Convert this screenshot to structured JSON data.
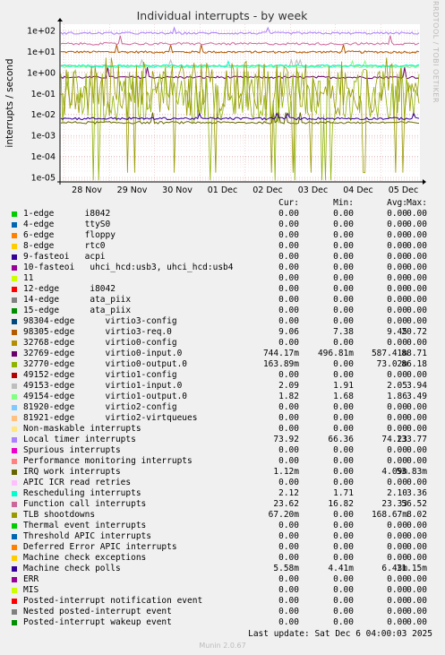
{
  "chart_data": {
    "type": "line",
    "title": "Individual interrupts - by week",
    "ylabel": "interrupts / second",
    "yscale": "log",
    "ylim": [
      7e-06,
      200
    ],
    "yticks": [
      "1e+02",
      "1e+01",
      "1e+00",
      "1e-01",
      "1e-02",
      "1e-03",
      "1e-04",
      "1e-05"
    ],
    "xticks": [
      "28 Nov",
      "29 Nov",
      "30 Nov",
      "01 Dec",
      "02 Dec",
      "03 Dec",
      "04 Dec",
      "05 Dec"
    ],
    "side_label": "RRDTOOL / TOBI OETIKER",
    "columns": [
      "Cur:",
      "Min:",
      "Avg:",
      "Max:"
    ],
    "series": [
      {
        "name": "1-edge      i8042",
        "color": "#00cc00",
        "cur": "0.00",
        "min": "0.00",
        "avg": "0.00",
        "max": "0.00"
      },
      {
        "name": "4-edge      ttyS0",
        "color": "#0066b3",
        "cur": "0.00",
        "min": "0.00",
        "avg": "0.00",
        "max": "0.00"
      },
      {
        "name": "6-edge      floppy",
        "color": "#ff8000",
        "cur": "0.00",
        "min": "0.00",
        "avg": "0.00",
        "max": "0.00"
      },
      {
        "name": "8-edge      rtc0",
        "color": "#ffcc00",
        "cur": "0.00",
        "min": "0.00",
        "avg": "0.00",
        "max": "0.00"
      },
      {
        "name": "9-fasteoi   acpi",
        "color": "#330099",
        "cur": "0.00",
        "min": "0.00",
        "avg": "0.00",
        "max": "0.00"
      },
      {
        "name": "10-fasteoi   uhci_hcd:usb3, uhci_hcd:usb4",
        "color": "#990099",
        "cur": "0.00",
        "min": "0.00",
        "avg": "0.00",
        "max": "0.00"
      },
      {
        "name": "11",
        "color": "#ccff00",
        "cur": "0.00",
        "min": "0.00",
        "avg": "0.00",
        "max": "0.00"
      },
      {
        "name": "12-edge      i8042",
        "color": "#ff0000",
        "cur": "0.00",
        "min": "0.00",
        "avg": "0.00",
        "max": "0.00"
      },
      {
        "name": "14-edge      ata_piix",
        "color": "#808080",
        "cur": "0.00",
        "min": "0.00",
        "avg": "0.00",
        "max": "0.00"
      },
      {
        "name": "15-edge      ata_piix",
        "color": "#008f00",
        "cur": "0.00",
        "min": "0.00",
        "avg": "0.00",
        "max": "0.00"
      },
      {
        "name": "98304-edge      virtio3-config",
        "color": "#00487d",
        "cur": "0.00",
        "min": "0.00",
        "avg": "0.00",
        "max": "0.00"
      },
      {
        "name": "98305-edge      virtio3-req.0",
        "color": "#b35a00",
        "cur": "9.06",
        "min": "7.38",
        "avg": "9.45",
        "max": "20.72"
      },
      {
        "name": "32768-edge      virtio0-config",
        "color": "#b38f00",
        "cur": "0.00",
        "min": "0.00",
        "avg": "0.00",
        "max": "0.00"
      },
      {
        "name": "32769-edge      virtio0-input.0",
        "color": "#6b006b",
        "cur": "744.17m",
        "min": "496.81m",
        "avg": "587.41m",
        "max": "88.71"
      },
      {
        "name": "32770-edge      virtio0-output.0",
        "color": "#8fb300",
        "cur": "163.89m",
        "min": "0.00",
        "avg": "73.02m",
        "max": "86.18"
      },
      {
        "name": "49152-edge      virtio1-config",
        "color": "#b30000",
        "cur": "0.00",
        "min": "0.00",
        "avg": "0.00",
        "max": "0.00"
      },
      {
        "name": "49153-edge      virtio1-input.0",
        "color": "#bebebe",
        "cur": "2.09",
        "min": "1.91",
        "avg": "2.05",
        "max": "3.94"
      },
      {
        "name": "49154-edge      virtio1-output.0",
        "color": "#80ff80",
        "cur": "1.82",
        "min": "1.68",
        "avg": "1.86",
        "max": "3.49"
      },
      {
        "name": "81920-edge      virtio2-config",
        "color": "#80c9ff",
        "cur": "0.00",
        "min": "0.00",
        "avg": "0.00",
        "max": "0.00"
      },
      {
        "name": "81921-edge      virtio2-virtqueues",
        "color": "#ffc080",
        "cur": "0.00",
        "min": "0.00",
        "avg": "0.00",
        "max": "0.00"
      },
      {
        "name": "Non-maskable interrupts",
        "color": "#ffe680",
        "cur": "0.00",
        "min": "0.00",
        "avg": "0.00",
        "max": "0.00"
      },
      {
        "name": "Local timer interrupts",
        "color": "#aa80ff",
        "cur": "73.92",
        "min": "66.36",
        "avg": "74.23",
        "max": "133.77"
      },
      {
        "name": "Spurious interrupts",
        "color": "#ee00cc",
        "cur": "0.00",
        "min": "0.00",
        "avg": "0.00",
        "max": "0.00"
      },
      {
        "name": "Performance monitoring interrupts",
        "color": "#ff8080",
        "cur": "0.00",
        "min": "0.00",
        "avg": "0.00",
        "max": "0.00"
      },
      {
        "name": "IRQ work interrupts",
        "color": "#666600",
        "cur": "1.12m",
        "min": "0.00",
        "avg": "4.09m",
        "max": "53.83m"
      },
      {
        "name": "APIC ICR read retries",
        "color": "#ffbfff",
        "cur": "0.00",
        "min": "0.00",
        "avg": "0.00",
        "max": "0.00"
      },
      {
        "name": "Rescheduling interrupts",
        "color": "#00ffcc",
        "cur": "2.12",
        "min": "1.71",
        "avg": "2.10",
        "max": "3.36"
      },
      {
        "name": "Function call interrupts",
        "color": "#cc6699",
        "cur": "23.62",
        "min": "16.82",
        "avg": "23.33",
        "max": "56.52"
      },
      {
        "name": "TLB shootdowns",
        "color": "#999900",
        "cur": "67.20m",
        "min": "0.00",
        "avg": "168.67m",
        "max": "8.02"
      },
      {
        "name": "Thermal event interrupts",
        "color": "#00cc00",
        "cur": "0.00",
        "min": "0.00",
        "avg": "0.00",
        "max": "0.00"
      },
      {
        "name": "Threshold APIC interrupts",
        "color": "#0066b3",
        "cur": "0.00",
        "min": "0.00",
        "avg": "0.00",
        "max": "0.00"
      },
      {
        "name": "Deferred Error APIC interrupts",
        "color": "#ff8000",
        "cur": "0.00",
        "min": "0.00",
        "avg": "0.00",
        "max": "0.00"
      },
      {
        "name": "Machine check exceptions",
        "color": "#ffcc00",
        "cur": "0.00",
        "min": "0.00",
        "avg": "0.00",
        "max": "0.00"
      },
      {
        "name": "Machine check polls",
        "color": "#330099",
        "cur": "5.58m",
        "min": "4.41m",
        "avg": "6.43m",
        "max": "11.15m"
      },
      {
        "name": "ERR",
        "color": "#990099",
        "cur": "0.00",
        "min": "0.00",
        "avg": "0.00",
        "max": "0.00"
      },
      {
        "name": "MIS",
        "color": "#ccff00",
        "cur": "0.00",
        "min": "0.00",
        "avg": "0.00",
        "max": "0.00"
      },
      {
        "name": "Posted-interrupt notification event",
        "color": "#ff0000",
        "cur": "0.00",
        "min": "0.00",
        "avg": "0.00",
        "max": "0.00"
      },
      {
        "name": "Nested posted-interrupt event",
        "color": "#808080",
        "cur": "0.00",
        "min": "0.00",
        "avg": "0.00",
        "max": "0.00"
      },
      {
        "name": "Posted-interrupt wakeup event",
        "color": "#008f00",
        "cur": "0.00",
        "min": "0.00",
        "avg": "0.00",
        "max": "0.00"
      }
    ],
    "last_update": "Last update: Sat Dec  6 04:00:03 2025",
    "footer": "Munin 2.0.67"
  }
}
